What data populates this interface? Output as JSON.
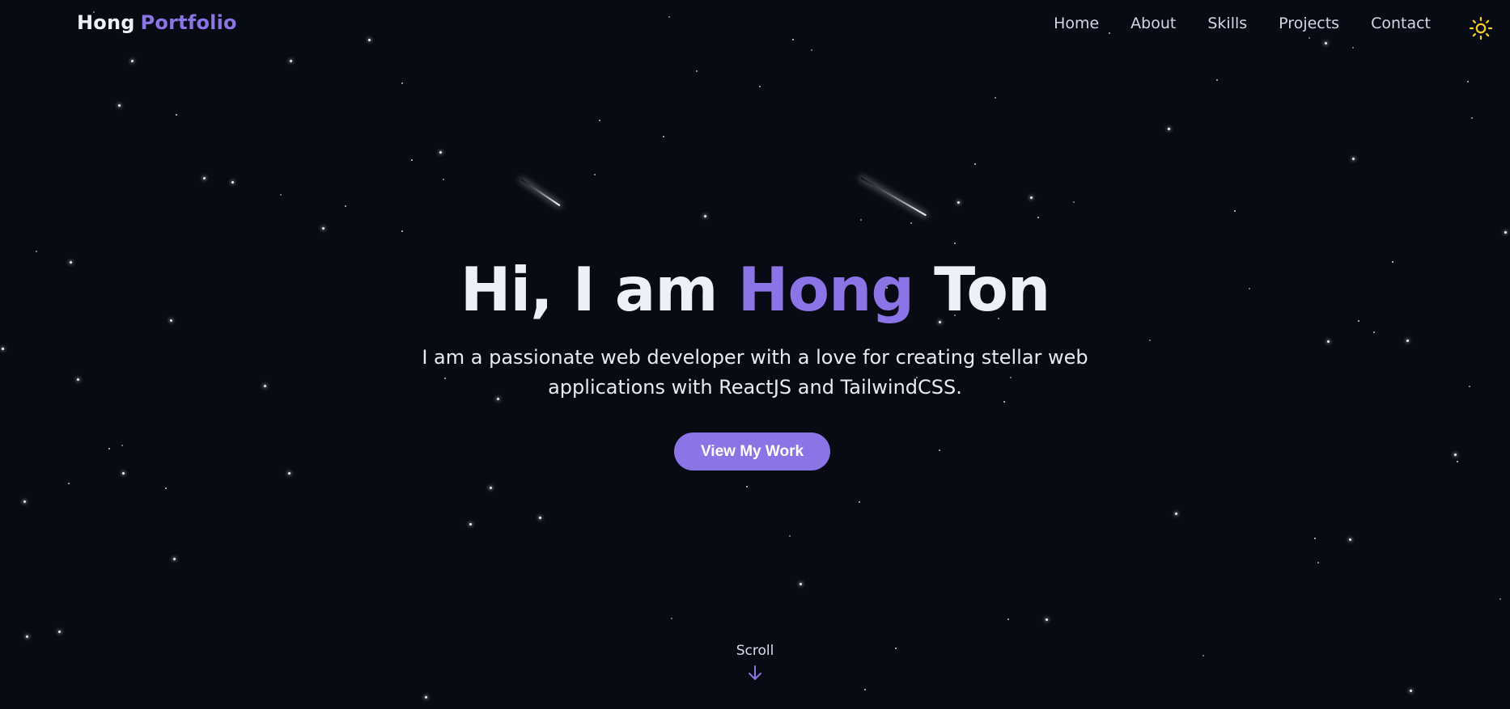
{
  "nav": {
    "brand": {
      "first": "Hong",
      "accent": "Portfolio"
    },
    "links": [
      "Home",
      "About",
      "Skills",
      "Projects",
      "Contact"
    ],
    "theme_toggle_icon": "sun-icon"
  },
  "hero": {
    "greeting": "Hi, I am",
    "first_name": "Hong",
    "last_name": "Ton",
    "subtitle": "I am a passionate web developer with a love for creating stellar web applications with ReactJS and TailwindCSS.",
    "cta_label": "View My Work"
  },
  "scroll": {
    "label": "Scroll",
    "icon": "arrow-down-icon"
  },
  "colors": {
    "background": "#080b14",
    "accent": "#8b74e6",
    "text": "#eef0f8",
    "sun": "#f6d21a"
  }
}
